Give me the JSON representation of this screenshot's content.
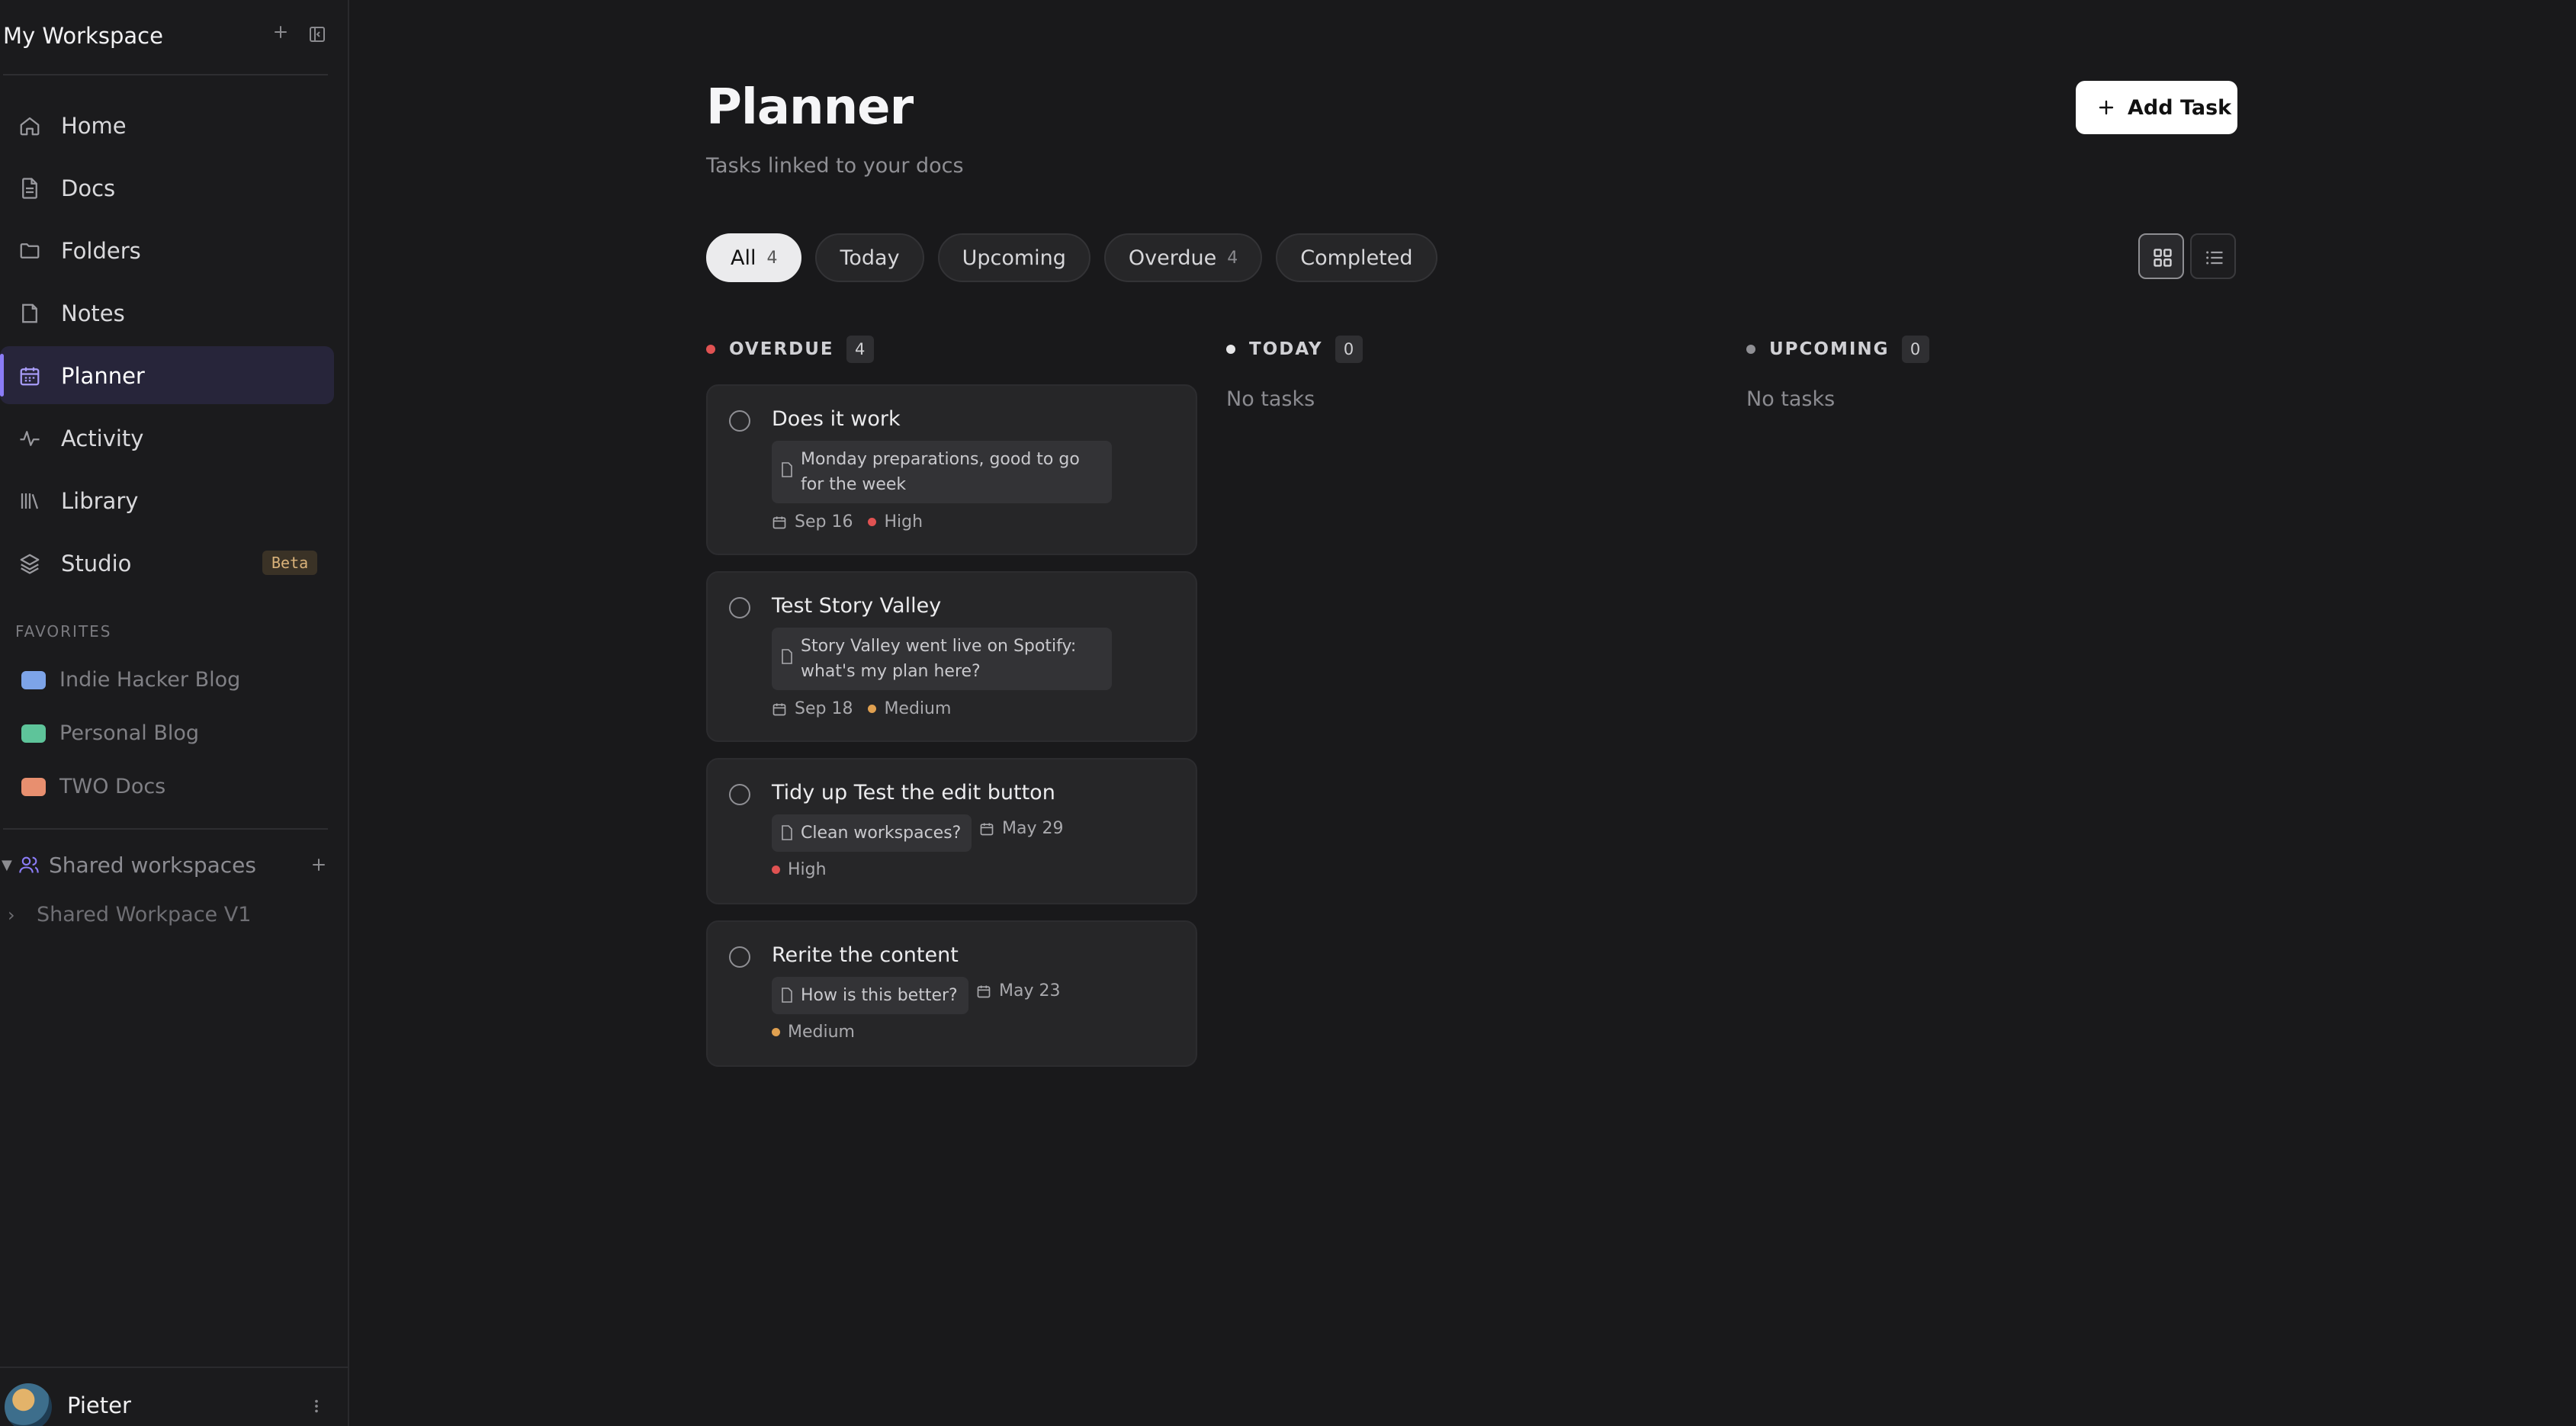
{
  "workspace": {
    "title": "My Workspace"
  },
  "nav": {
    "items": [
      {
        "label": "Home",
        "icon": "home-icon"
      },
      {
        "label": "Docs",
        "icon": "doc-icon"
      },
      {
        "label": "Folders",
        "icon": "folder-icon"
      },
      {
        "label": "Notes",
        "icon": "note-icon"
      },
      {
        "label": "Planner",
        "icon": "calendar-icon",
        "active": true
      },
      {
        "label": "Activity",
        "icon": "activity-icon"
      },
      {
        "label": "Library",
        "icon": "library-icon"
      },
      {
        "label": "Studio",
        "icon": "layers-icon",
        "badge": "Beta"
      }
    ]
  },
  "favorites": {
    "title": "FAVORITES",
    "items": [
      {
        "label": "Indie Hacker Blog",
        "color": "#7da4e8"
      },
      {
        "label": "Personal Blog",
        "color": "#5ec49a"
      },
      {
        "label": "TWO Docs",
        "color": "#e88f6f"
      }
    ]
  },
  "shared": {
    "title": "Shared workspaces",
    "items": [
      {
        "label": "Shared Workpace V1"
      }
    ]
  },
  "user": {
    "name": "Pieter"
  },
  "main": {
    "title": "Planner",
    "subtitle": "Tasks linked to your docs",
    "add_task_label": "Add Task"
  },
  "filters": [
    {
      "label": "All",
      "count": "4",
      "active": true
    },
    {
      "label": "Today",
      "count": ""
    },
    {
      "label": "Upcoming",
      "count": ""
    },
    {
      "label": "Overdue",
      "count": "4"
    },
    {
      "label": "Completed",
      "count": ""
    }
  ],
  "columns": [
    {
      "title": "OVERDUE",
      "count": "4",
      "color": "#e05252"
    },
    {
      "title": "TODAY",
      "count": "0",
      "color": "#e6e6e8",
      "empty": "No tasks"
    },
    {
      "title": "UPCOMING",
      "count": "0",
      "color": "#8f8f94",
      "empty": "No tasks"
    }
  ],
  "tasks": [
    {
      "title": "Does it work",
      "doc": "Monday preparations, good to go for the week",
      "date": "Sep 16",
      "priority": "High",
      "priority_color": "#e05252"
    },
    {
      "title": "Test Story Valley",
      "doc": "Story Valley went live on Spotify: what's my plan here?",
      "date": "Sep 18",
      "priority": "Medium",
      "priority_color": "#e0a050"
    },
    {
      "title": "Tidy up Test the edit button",
      "doc": "Clean workspaces?",
      "date": "May 29",
      "priority": "High",
      "priority_color": "#e05252"
    },
    {
      "title": "Rerite the content",
      "doc": "How is this better?",
      "date": "May 23",
      "priority": "Medium",
      "priority_color": "#e0a050"
    }
  ]
}
